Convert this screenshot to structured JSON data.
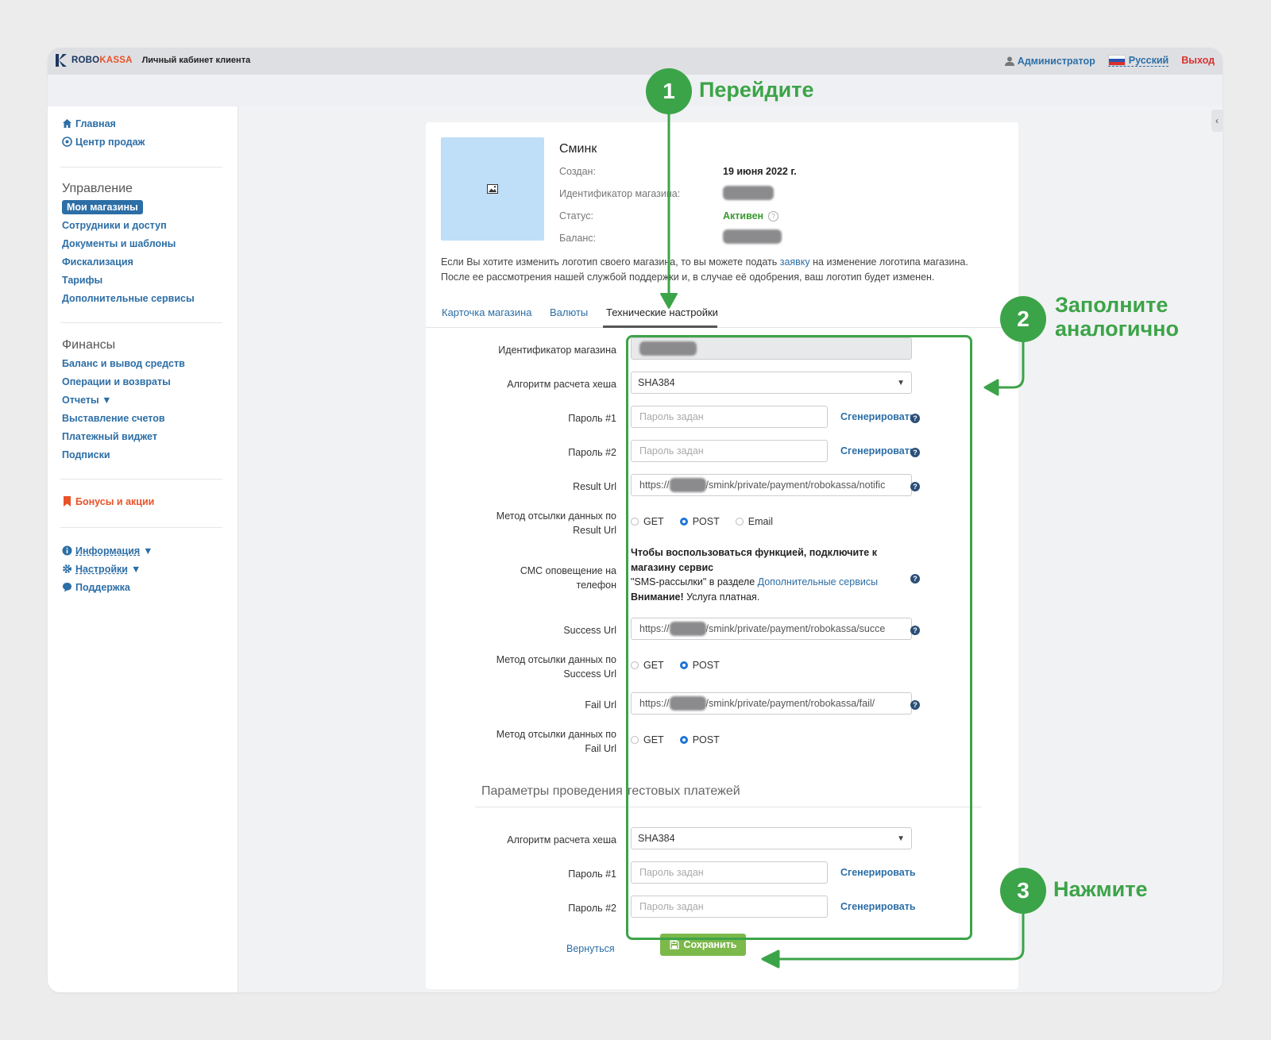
{
  "header": {
    "logo_robo": "ROBO",
    "logo_kassa": "KASSA",
    "cabinet": "Личный кабинет клиента",
    "admin": "Администратор",
    "language": "Русский",
    "logout": "Выход"
  },
  "sidebar": {
    "home": "Главная",
    "sales_center": "Центр продаж",
    "management_title": "Управление",
    "my_shops": "Мои магазины",
    "staff": "Сотрудники и доступ",
    "documents": "Документы и шаблоны",
    "fiscal": "Фискализация",
    "tariffs": "Тарифы",
    "extra_services": "Дополнительные сервисы",
    "finance_title": "Финансы",
    "balance": "Баланс и вывод средств",
    "operations": "Операции и возвраты",
    "reports": "Отчеты ▼",
    "invoices": "Выставление счетов",
    "widget": "Платежный виджет",
    "subscriptions": "Подписки",
    "bonuses": "Бонусы и акции",
    "info": "Информация",
    "settings": "Настройки",
    "support": "Поддержка"
  },
  "shop": {
    "name": "Сминк",
    "created_label": "Создан:",
    "created_value": "19 июня 2022 г.",
    "id_label": "Идентификатор магазина:",
    "status_label": "Статус:",
    "status_value": "Активен",
    "balance_label": "Баланс:",
    "notice_1": "Если Вы хотите изменить логотип своего магазина, то вы можете подать ",
    "notice_link": "заявку",
    "notice_2": " на изменение логотипа магазина.",
    "notice_3": "После ее рассмотрения нашей службой поддержки и, в случае её одобрения, ваш логотип будет изменен."
  },
  "tabs": [
    "Карточка магазина",
    "Валюты",
    "Технические настройки"
  ],
  "form": {
    "shop_id_label": "Идентификатор магазина",
    "hash_label": "Алгоритм расчета хеша",
    "hash_value": "SHA384",
    "pass1_label": "Пароль #1",
    "pass2_label": "Пароль #2",
    "pass_placeholder": "Пароль задан",
    "generate": "Сгенерировать",
    "result_url_label": "Result Url",
    "result_url_prefix": "https://",
    "result_url_suffix": "/smink/private/payment/robokassa/notific",
    "method_result_label_1": "Метод отсылки данных по",
    "method_result_label_2": "Result Url",
    "get": "GET",
    "post": "POST",
    "email": "Email",
    "sms_label_1": "СМС оповещение на",
    "sms_label_2": "телефон",
    "sms_text_1": "Чтобы воспользоваться функцией, подключите к",
    "sms_text_2": "магазину сервис",
    "sms_text_3": "\"SMS-рассылки\" в разделе ",
    "sms_link": "Дополнительные сервисы",
    "sms_warn": "Внимание!",
    "sms_paid": " Услуга платная.",
    "success_url_label": "Success Url",
    "success_url_prefix": "https://",
    "success_url_suffix": "/smink/private/payment/robokassa/succe",
    "method_success_label_1": "Метод отсылки данных по",
    "method_success_label_2": "Success Url",
    "fail_url_label": "Fail Url",
    "fail_url_prefix": "https://",
    "fail_url_suffix": "/smink/private/payment/robokassa/fail/",
    "method_fail_label_1": "Метод отсылки данных по",
    "method_fail_label_2": "Fail Url",
    "test_section": "Параметры проведения тестовых платежей",
    "test_hash_value": "SHA384",
    "back": "Вернуться",
    "save": "Сохранить"
  },
  "annotations": {
    "step1_num": "1",
    "step1_text": "Перейдите",
    "step2_num": "2",
    "step2_text_1": "Заполните",
    "step2_text_2": "аналогично",
    "step3_num": "3",
    "step3_text": "Нажмите"
  },
  "colors": {
    "accent": "#2c6ea6",
    "annotation": "#3ca448",
    "save_button": "#7cb84a",
    "logout": "#d7322f"
  }
}
